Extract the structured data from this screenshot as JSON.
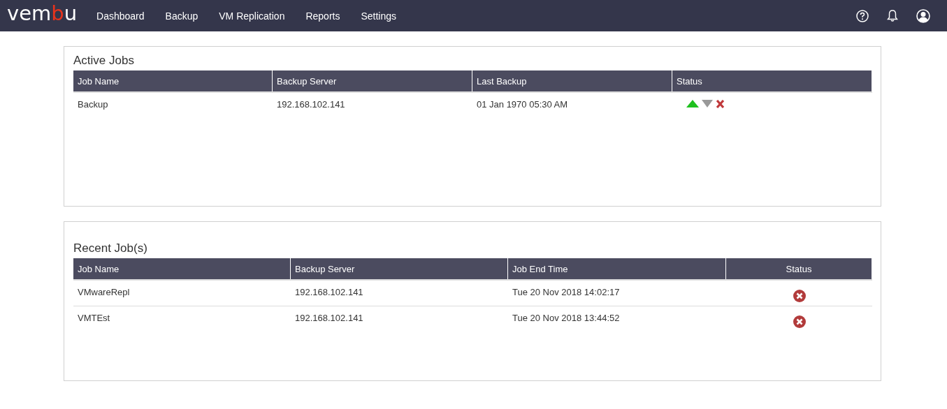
{
  "logo": {
    "parts": [
      {
        "text": "vem",
        "accent": false
      },
      {
        "text": "b",
        "accent": true
      },
      {
        "text": "u",
        "accent": false
      }
    ]
  },
  "nav": [
    {
      "label": "Dashboard"
    },
    {
      "label": "Backup"
    },
    {
      "label": "VM Replication"
    },
    {
      "label": "Reports"
    },
    {
      "label": "Settings"
    }
  ],
  "active_jobs": {
    "title": "Active Jobs",
    "columns": [
      {
        "label": "Job Name"
      },
      {
        "label": "Backup Server"
      },
      {
        "label": "Last Backup"
      },
      {
        "label": "Status"
      }
    ],
    "rows": [
      {
        "job_name": "Backup",
        "backup_server": "192.168.102.141",
        "time": "01 Jan 1970 05:30 AM",
        "status": {
          "kind": "running"
        }
      }
    ]
  },
  "recent_jobs": {
    "title": "Recent Job(s)",
    "columns": [
      {
        "label": "Job Name"
      },
      {
        "label": "Backup Server"
      },
      {
        "label": "Job End Time"
      },
      {
        "label": "Status",
        "centered": true
      }
    ],
    "rows": [
      {
        "job_name": "VMwareRepl",
        "backup_server": "192.168.102.141",
        "time": "Tue 20 Nov 2018 14:02:17",
        "status": {
          "kind": "failed"
        }
      },
      {
        "job_name": "VMTEst",
        "backup_server": "192.168.102.141",
        "time": "Tue 20 Nov 2018 13:44:52",
        "status": {
          "kind": "failed"
        }
      }
    ]
  }
}
